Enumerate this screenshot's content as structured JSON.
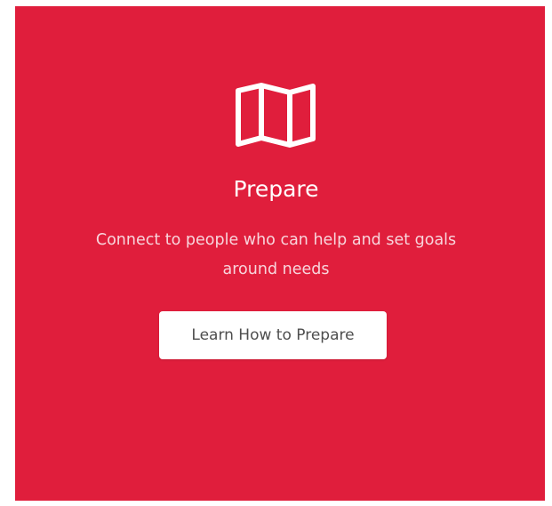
{
  "card": {
    "title": "Prepare",
    "description": "Connect to people who can help and set goals around needs",
    "icon": "map-icon",
    "button_label": "Learn How to Prepare"
  },
  "colors": {
    "card_background": "#e01e3c",
    "title_text": "#ffffff",
    "description_text": "#f8d5dc",
    "button_background": "#ffffff",
    "button_text": "#4e4e4e"
  }
}
